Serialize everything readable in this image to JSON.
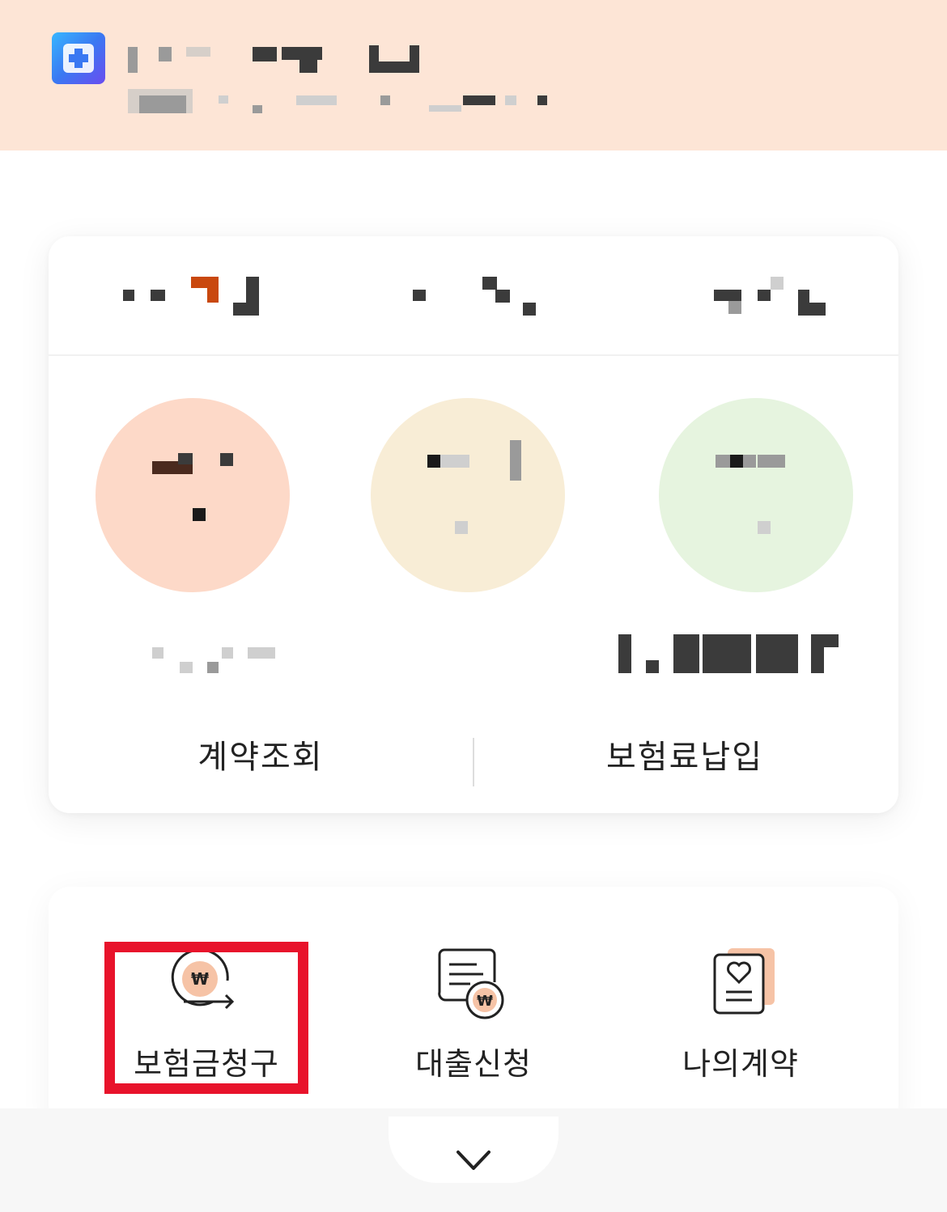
{
  "main_card": {
    "actions": [
      {
        "label": "계약조회"
      },
      {
        "label": "보험료납입"
      }
    ]
  },
  "quick_menu": {
    "items": [
      {
        "label": "보험금청구",
        "icon": "claim-won-icon",
        "highlighted": true
      },
      {
        "label": "대출신청",
        "icon": "loan-document-icon"
      },
      {
        "label": "나의계약",
        "icon": "my-contract-heart-icon"
      }
    ]
  },
  "colors": {
    "banner_bg": "#fde5d6",
    "highlight_border": "#e8132b",
    "peach_circle": "#fdd9c8",
    "cream_circle": "#f8edd6",
    "green_circle": "#e6f4df",
    "accent_peach": "#f6c3a6"
  },
  "bottom": {
    "icon": "chevron-down-icon"
  }
}
